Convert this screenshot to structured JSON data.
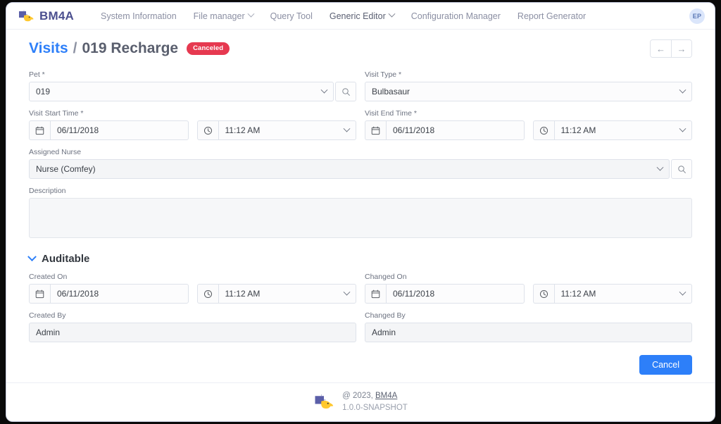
{
  "navbar": {
    "brand": "BM4A",
    "items": [
      {
        "label": "System Information",
        "has_caret": false
      },
      {
        "label": "File manager",
        "has_caret": true
      },
      {
        "label": "Query Tool",
        "has_caret": false
      },
      {
        "label": "Generic Editor",
        "has_caret": true
      },
      {
        "label": "Configuration Manager",
        "has_caret": false
      },
      {
        "label": "Report Generator",
        "has_caret": false
      }
    ],
    "avatar_initials": "EP"
  },
  "header": {
    "title_link": "Visits",
    "separator": "/",
    "title_record": "019 Recharge",
    "status_badge": "Canceled",
    "prev_arrow": "←",
    "next_arrow": "→"
  },
  "form": {
    "pet": {
      "label": "Pet *",
      "value": "019"
    },
    "visit_type": {
      "label": "Visit Type *",
      "value": "Bulbasaur"
    },
    "visit_start": {
      "label": "Visit Start Time *",
      "date": "06/11/2018",
      "time": "11:12 AM"
    },
    "visit_end": {
      "label": "Visit End Time *",
      "date": "06/11/2018",
      "time": "11:12 AM"
    },
    "assigned_nurse": {
      "label": "Assigned Nurse",
      "value": "Nurse (Comfey)"
    },
    "description": {
      "label": "Description",
      "value": "",
      "placeholder": ""
    }
  },
  "auditable": {
    "section_title": "Auditable",
    "created_on": {
      "label": "Created On",
      "date": "06/11/2018",
      "time": "11:12 AM"
    },
    "changed_on": {
      "label": "Changed On",
      "date": "06/11/2018",
      "time": "11:12 AM"
    },
    "created_by": {
      "label": "Created By",
      "value": "Admin"
    },
    "changed_by": {
      "label": "Changed By",
      "value": "Admin"
    }
  },
  "actions": {
    "cancel_label": "Cancel"
  },
  "footer": {
    "copyright_prefix": "@ 2023, ",
    "copyright_link": "BM4A",
    "version": "1.0.0-SNAPSHOT"
  },
  "colors": {
    "accent": "#2d7ff9",
    "danger": "#e63950",
    "brand": "#4b4f8f",
    "avatar_bg": "#dbe6fb"
  }
}
